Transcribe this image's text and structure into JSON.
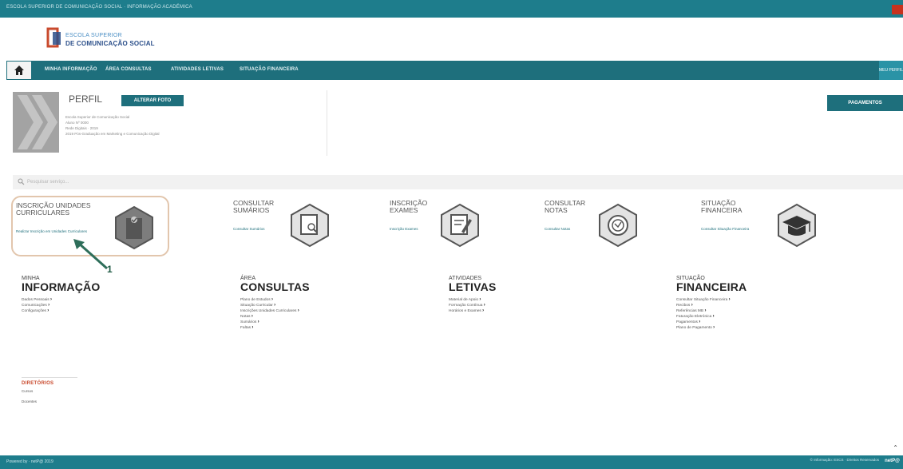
{
  "topbar": {
    "text": "ESCOLA SUPERIOR DE COMUNICAÇÃO SOCIAL · INFORMAÇÃO ACADÉMICA"
  },
  "logo": {
    "line1": "ESCOLA SUPERIOR",
    "line2": "DE COMUNICAÇÃO SOCIAL"
  },
  "nav": {
    "items": [
      "MINHA INFORMAÇÃO",
      "ÁREA CONSULTAS",
      "ATIVIDADES LETIVAS",
      "SITUAÇÃO FINANCEIRA"
    ],
    "right": "MEU PERFIL"
  },
  "profile": {
    "title": "PERFIL",
    "button": "ALTERAR FOTO",
    "info": [
      "Escola Superior de Comunicação Social",
      "Aluno Nº 0000",
      "Rede Digitais · 2019",
      "2019 Pós-Graduação em Marketing e Comunicação Digital"
    ]
  },
  "payments_button": "PAGAMENTOS",
  "search": {
    "placeholder": "Pesquisar serviço..."
  },
  "tiles": [
    {
      "title": "INSCRIÇÃO UNIDADES CURRICULARES",
      "link": "Realizar Inscrição em Unidades Curriculares",
      "icon": "clipboard-check-icon"
    },
    {
      "title": "CONSULTAR SUMÁRIOS",
      "link": "Consultar Sumários",
      "icon": "document-search-icon"
    },
    {
      "title": "INSCRIÇÃO EXAMES",
      "link": "Inscrição Exames",
      "icon": "edit-document-icon"
    },
    {
      "title": "CONSULTAR NOTAS",
      "link": "Consultar Notas",
      "icon": "grade-badge-icon"
    },
    {
      "title": "SITUAÇÃO FINANCEIRA",
      "link": "Consultar Situação Financeira",
      "icon": "graduation-cap-icon"
    }
  ],
  "annotation": {
    "number": "1"
  },
  "sections": [
    {
      "small": "MINHA",
      "big": "INFORMAÇÃO",
      "links": [
        "Dados Pessoais",
        "Comunicações",
        "Configurações"
      ]
    },
    {
      "small": "ÁREA",
      "big": "CONSULTAS",
      "links": [
        "Plano de Estudos",
        "Situação Curricular",
        "Inscrições Unidades Curriculares",
        "Notas",
        "Sumários",
        "Faltas"
      ]
    },
    {
      "small": "ATIVIDADES",
      "big": "LETIVAS",
      "links": [
        "Material de Apoio",
        "Formação Contínua",
        "Horários e Exames"
      ]
    },
    {
      "small": "SITUAÇÃO",
      "big": "FINANCEIRA",
      "links": [
        "Consultar Situação Financeira",
        "Recibos",
        "Referências MB",
        "Faturação Eletrónica",
        "Pagamentos",
        "Plano de Pagamento"
      ]
    }
  ],
  "diretorios": {
    "title": "DIRETÓRIOS",
    "links": [
      "Cursos",
      "Docentes"
    ]
  },
  "footer": {
    "left": "Powered by · netP@ 2019",
    "right": "© Informação: ESCS · Direitos Reservados",
    "brand": "netP@"
  },
  "colors": {
    "teal": "#1e6f7c",
    "orange_highlight": "#e2c6ad",
    "arrow_green": "#2e6e5a"
  }
}
